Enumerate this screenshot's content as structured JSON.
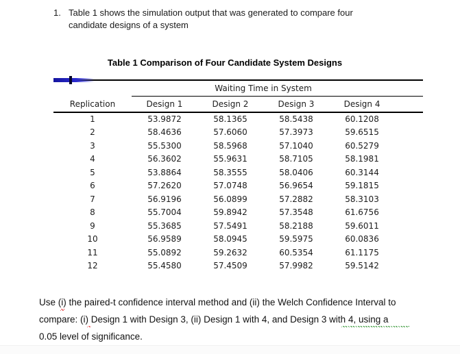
{
  "problem": {
    "number": "1.",
    "line1": "Table 1 shows the simulation output that was generated to compare four",
    "line2": "candidate designs of a system"
  },
  "table": {
    "caption": "Table 1 Comparison of Four Candidate System Designs",
    "group_header": "Waiting Time in System",
    "replication_header": "Replication",
    "design_headers": [
      "Design 1",
      "Design 2",
      "Design 3",
      "Design 4"
    ],
    "rows": [
      {
        "replication": "1",
        "values": [
          "53.9872",
          "58.1365",
          "58.5438",
          "60.1208"
        ]
      },
      {
        "replication": "2",
        "values": [
          "58.4636",
          "57.6060",
          "57.3973",
          "59.6515"
        ]
      },
      {
        "replication": "3",
        "values": [
          "55.5300",
          "58.5968",
          "57.1040",
          "60.5279"
        ]
      },
      {
        "replication": "4",
        "values": [
          "56.3602",
          "55.9631",
          "58.7105",
          "58.1981"
        ]
      },
      {
        "replication": "5",
        "values": [
          "53.8864",
          "58.3555",
          "58.0406",
          "60.3144"
        ]
      },
      {
        "replication": "6",
        "values": [
          "57.2620",
          "57.0748",
          "56.9654",
          "59.1815"
        ]
      },
      {
        "replication": "7",
        "values": [
          "56.9196",
          "56.0899",
          "57.2882",
          "58.3103"
        ]
      },
      {
        "replication": "8",
        "values": [
          "55.7004",
          "59.8942",
          "57.3548",
          "61.6756"
        ]
      },
      {
        "replication": "9",
        "values": [
          "55.3685",
          "57.5491",
          "58.2188",
          "59.6011"
        ]
      },
      {
        "replication": "10",
        "values": [
          "56.9589",
          "58.0945",
          "59.5975",
          "60.0836"
        ]
      },
      {
        "replication": "11",
        "values": [
          "55.0892",
          "59.2632",
          "60.5354",
          "61.1175"
        ]
      },
      {
        "replication": "12",
        "values": [
          "55.4580",
          "57.4509",
          "57.9982",
          "59.5142"
        ]
      }
    ]
  },
  "footer": {
    "line1": "Use (i) the paired-t confidence interval method and (ii) the Welch Confidence Interval to",
    "line2": "compare: (i) Design 1 with Design 3, (ii) Design 1 with 4, and Design 3 with 4, using a",
    "line3": "0.05 level of significance."
  },
  "colors": {
    "selection_accent_blue": "#2a2ad0",
    "spellcheck_red": "#e02020",
    "grammarcheck_green": "#1f8a1f",
    "rule_black": "#000000"
  }
}
